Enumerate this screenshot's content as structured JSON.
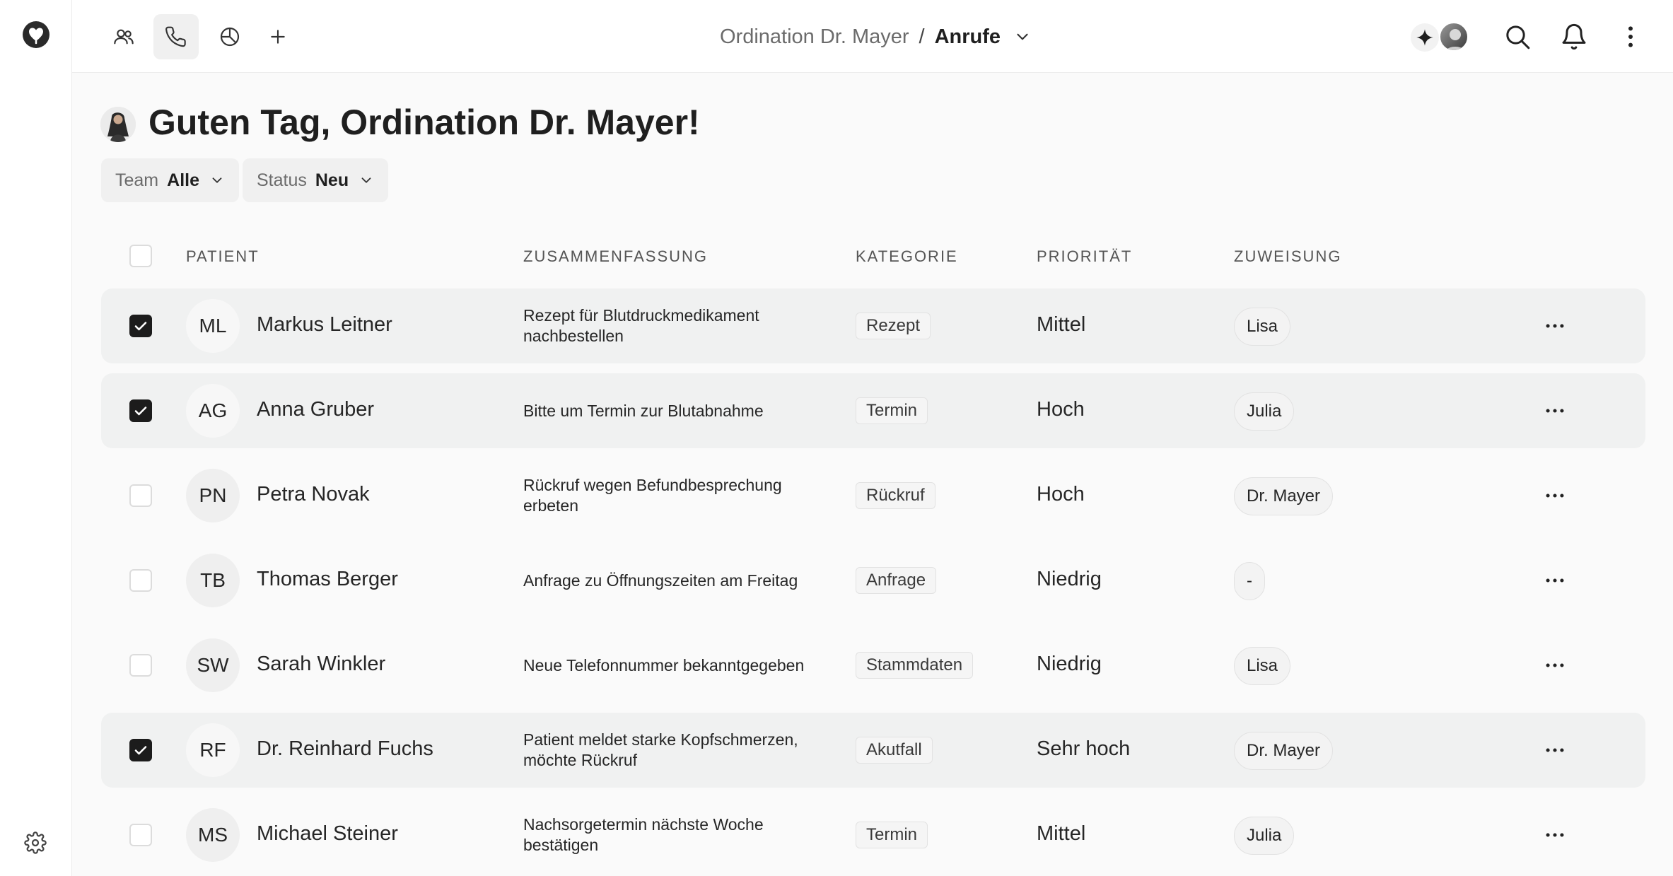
{
  "breadcrumb": {
    "practice": "Ordination Dr. Mayer",
    "separator": "/",
    "section": "Anrufe"
  },
  "greeting": "Guten Tag, Ordination Dr. Mayer!",
  "filters": [
    {
      "label": "Team",
      "value": "Alle"
    },
    {
      "label": "Status",
      "value": "Neu"
    }
  ],
  "table": {
    "columns": {
      "patient": "PATIENT",
      "summary": "ZUSAMMENFASSUNG",
      "category": "KATEGORIE",
      "priority": "PRIORITÄT",
      "assignment": "ZUWEISUNG"
    },
    "rows": [
      {
        "selected": true,
        "initials": "ML",
        "name": "Markus Leitner",
        "summary": "Rezept für Blutdruckmedikament nachbestellen",
        "category": "Rezept",
        "priority": "Mittel",
        "assignee": "Lisa"
      },
      {
        "selected": true,
        "initials": "AG",
        "name": "Anna Gruber",
        "summary": "Bitte um Termin zur Blutabnahme",
        "category": "Termin",
        "priority": "Hoch",
        "assignee": "Julia"
      },
      {
        "selected": false,
        "initials": "PN",
        "name": "Petra Novak",
        "summary": "Rückruf wegen Befundbesprechung erbeten",
        "category": "Rückruf",
        "priority": "Hoch",
        "assignee": "Dr. Mayer"
      },
      {
        "selected": false,
        "initials": "TB",
        "name": "Thomas Berger",
        "summary": "Anfrage zu Öffnungszeiten am Freitag",
        "category": "Anfrage",
        "priority": "Niedrig",
        "assignee": "-"
      },
      {
        "selected": false,
        "initials": "SW",
        "name": "Sarah Winkler",
        "summary": "Neue Telefonnummer bekanntgegeben",
        "category": "Stammdaten",
        "priority": "Niedrig",
        "assignee": "Lisa"
      },
      {
        "selected": true,
        "initials": "RF",
        "name": "Dr. Reinhard Fuchs",
        "summary": "Patient meldet starke Kopfschmerzen, möchte Rückruf",
        "category": "Akutfall",
        "priority": "Sehr hoch",
        "assignee": "Dr. Mayer"
      },
      {
        "selected": false,
        "initials": "MS",
        "name": "Michael Steiner",
        "summary": "Nachsorgetermin nächste Woche bestätigen",
        "category": "Termin",
        "priority": "Mittel",
        "assignee": "Julia"
      }
    ]
  },
  "icons": {
    "logo": "heart-stethoscope-icon",
    "settings": "gear-icon",
    "nav": [
      "users-icon",
      "phone-icon",
      "pie-chart-icon",
      "plus-icon"
    ],
    "top_right": [
      "sparkle-icon",
      "search-icon",
      "bell-icon",
      "more-vertical-icon"
    ],
    "row_action": "more-horizontal-icon"
  },
  "colors": {
    "background": "#fafafa",
    "surface": "#ffffff",
    "selected_row": "#f0f1f1",
    "checkbox_checked": "#1c1c1c",
    "text": "#262626"
  }
}
